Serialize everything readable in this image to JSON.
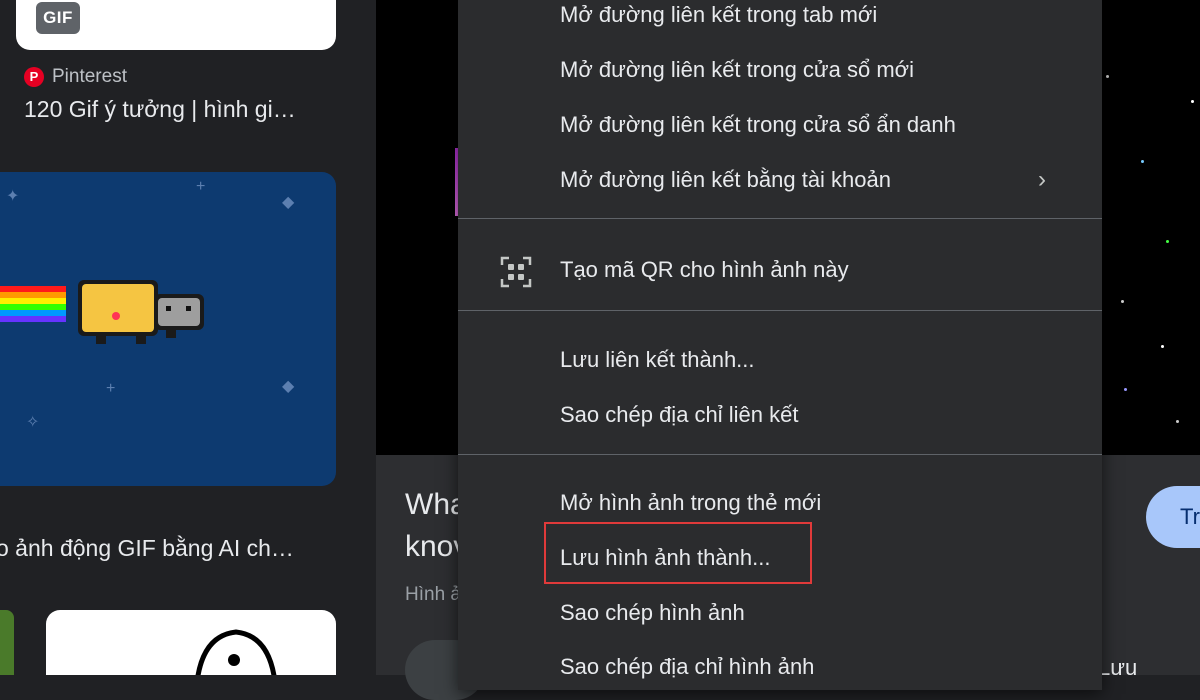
{
  "left_results": {
    "top_card": {
      "badge": "GIF"
    },
    "source": {
      "name": "Pinterest",
      "icon": "pinterest-icon"
    },
    "result_title": "120 Gif ý tưởng | hình gi…",
    "nyan_card": {
      "image": "nyan-cat-gif"
    },
    "second_title": "o ảnh động GIF bằng AI ch…"
  },
  "info_panel": {
    "title_line1": "Wha",
    "title_line2": "knov",
    "subtitle": "Hình ả",
    "visit_button": "Tr",
    "save_button": "Lưu"
  },
  "context_menu": {
    "items": [
      {
        "label": "Mở đường liên kết trong tab mới"
      },
      {
        "label": "Mở đường liên kết trong cửa sổ mới"
      },
      {
        "label": "Mở đường liên kết trong cửa sổ ẩn danh"
      },
      {
        "label": "Mở đường liên kết bằng tài khoản",
        "submenu": true
      },
      {
        "label": "Tạo mã QR cho hình ảnh này",
        "icon": "qr-code-icon"
      },
      {
        "label": "Lưu liên kết thành..."
      },
      {
        "label": "Sao chép địa chỉ liên kết"
      },
      {
        "label": "Mở hình ảnh trong thẻ mới"
      },
      {
        "label": "Lưu hình ảnh thành...",
        "highlighted": true
      },
      {
        "label": "Sao chép hình ảnh"
      },
      {
        "label": "Sao chép địa chỉ hình ảnh"
      }
    ],
    "submenu_glyph": "›",
    "highlight_color": "#e03a3a"
  },
  "colors": {
    "menu_bg": "#2b2c2e",
    "page_bg": "#202124",
    "accent_pill": "#a8c7fa",
    "nyan_bg": "#0d3a70"
  }
}
